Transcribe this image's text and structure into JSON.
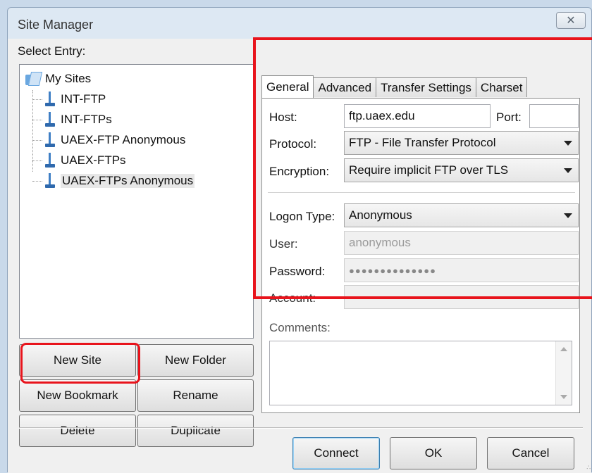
{
  "window": {
    "title": "Site Manager"
  },
  "tree": {
    "select_label": "Select Entry:",
    "root": "My Sites",
    "items": [
      "INT-FTP",
      "INT-FTPs",
      "UAEX-FTP Anonymous",
      "UAEX-FTPs",
      "UAEX-FTPs Anonymous"
    ],
    "selected": "UAEX-FTPs Anonymous"
  },
  "buttons": {
    "new_site": "New Site",
    "new_folder": "New Folder",
    "new_bookmark": "New Bookmark",
    "rename": "Rename",
    "delete": "Delete",
    "duplicate": "Duplicate",
    "connect": "Connect",
    "ok": "OK",
    "cancel": "Cancel"
  },
  "tabs": [
    "General",
    "Advanced",
    "Transfer Settings",
    "Charset"
  ],
  "general": {
    "host_label": "Host:",
    "host_value": "ftp.uaex.edu",
    "port_label": "Port:",
    "port_value": "",
    "protocol_label": "Protocol:",
    "protocol_value": "FTP - File Transfer Protocol",
    "encryption_label": "Encryption:",
    "encryption_value": "Require implicit FTP over TLS",
    "logon_label": "Logon Type:",
    "logon_value": "Anonymous",
    "user_label": "User:",
    "user_value": "anonymous",
    "password_label": "Password:",
    "password_value": "●●●●●●●●●●●●●●",
    "account_label": "Account:",
    "account_value": "",
    "comments_label": "Comments:"
  },
  "colors": {
    "highlight": "#e8141c",
    "accent": "#3f7fc5"
  },
  "icons": {
    "close": "close-icon",
    "folder": "folder-icon",
    "server": "server-icon",
    "dropdown": "chevron-down-icon"
  }
}
